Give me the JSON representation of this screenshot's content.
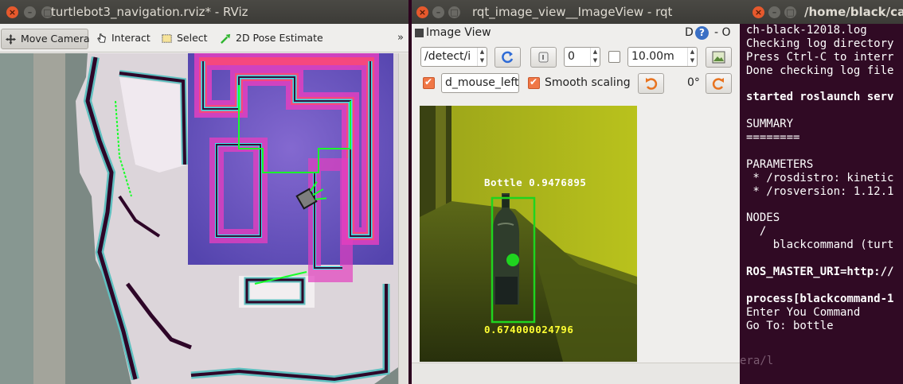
{
  "rviz": {
    "title": "turtlebot3_navigation.rviz* - RViz",
    "tools": [
      {
        "label": "Move Camera",
        "icon": "move-camera-icon"
      },
      {
        "label": "Interact",
        "icon": "hand-cursor-icon"
      },
      {
        "label": "Select",
        "icon": "select-box-icon"
      },
      {
        "label": "2D Pose Estimate",
        "icon": "pose-arrow-icon"
      }
    ],
    "more": "»"
  },
  "image_view": {
    "title": "rqt_image_view__ImageView - rqt",
    "panel_title": "Image View",
    "panel_badge": "D",
    "panel_controls": "- O",
    "topic": "/detect/i",
    "rotation_value": "0",
    "max_range": "10.00m",
    "mouse_topic": "d_mouse_left",
    "smooth_scaling_label": "Smooth scaling",
    "smooth_scaling_checked": true,
    "mouse_checked": true,
    "range_checked": false,
    "rotation_label": "0°",
    "detection": {
      "label": "Bottle 0.9476895",
      "distance": "0.674000024796",
      "box_color": "#1fd41f",
      "text_color": "#ffff33"
    }
  },
  "terminal": {
    "title": "/home/black/catki",
    "lines": [
      {
        "text": "ch-black-12018.log",
        "bold": false
      },
      {
        "text": "Checking log directory",
        "bold": false
      },
      {
        "text": "Press Ctrl-C to interr",
        "bold": false
      },
      {
        "text": "Done checking log file",
        "bold": false
      },
      {
        "text": "",
        "bold": false
      },
      {
        "text": "started roslaunch serv",
        "bold": true
      },
      {
        "text": "",
        "bold": false
      },
      {
        "text": "SUMMARY",
        "bold": false
      },
      {
        "text": "========",
        "bold": false
      },
      {
        "text": "",
        "bold": false
      },
      {
        "text": "PARAMETERS",
        "bold": false
      },
      {
        "text": " * /rosdistro: kinetic",
        "bold": false
      },
      {
        "text": " * /rosversion: 1.12.1",
        "bold": false
      },
      {
        "text": "",
        "bold": false
      },
      {
        "text": "NODES",
        "bold": false
      },
      {
        "text": "  /",
        "bold": false
      },
      {
        "text": "    blackcommand (turt",
        "bold": false
      },
      {
        "text": "",
        "bold": false
      },
      {
        "text": "ROS_MASTER_URI=http://",
        "bold": true
      },
      {
        "text": "",
        "bold": false
      },
      {
        "text": "process[blackcommand-1",
        "bold": true
      },
      {
        "text": "Enter You Command",
        "bold": false
      },
      {
        "text": "Go To: bottle",
        "bold": false
      }
    ],
    "background_peek": "era/l"
  },
  "colors": {
    "ubuntu_close": "#e6592d",
    "titlebar": "#3c3b37",
    "terminal_bg": "#300a24",
    "path_green": "#19ff2a",
    "costmap_cyan": "#35e6e6",
    "costmap_magenta": "#ff2bd6"
  }
}
